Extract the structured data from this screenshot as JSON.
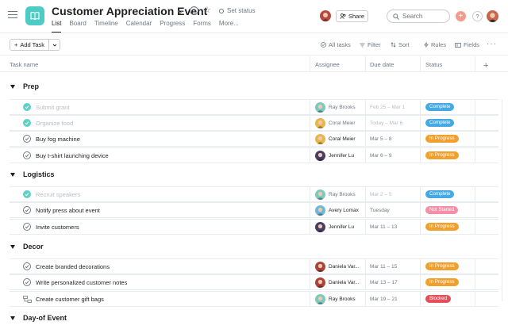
{
  "header": {
    "title": "Customer Appreciation Event",
    "set_status": "Set status",
    "tabs": [
      {
        "label": "List",
        "active": true
      },
      {
        "label": "Board"
      },
      {
        "label": "Timeline"
      },
      {
        "label": "Calendar"
      },
      {
        "label": "Progress"
      },
      {
        "label": "Forms"
      },
      {
        "label": "More..."
      }
    ],
    "share_label": "Share",
    "search_placeholder": "Search",
    "plus_icon": "plus-icon",
    "help_label": "?"
  },
  "toolbar": {
    "add_task_label": "Add Task",
    "all_tasks_label": "All tasks",
    "filter_label": "Filter",
    "sort_label": "Sort",
    "rules_label": "Rules",
    "fields_label": "Fields"
  },
  "columns": {
    "task_name": "Task name",
    "assignee": "Assignee",
    "due_date": "Due date",
    "status": "Status",
    "add_column": "+"
  },
  "status_colors": {
    "Complete": "#45a9e6",
    "In Progress": "#f1a02d",
    "Not Started": "#f48fa8",
    "Blocked": "#e2505b"
  },
  "sections": [
    {
      "name": "Prep",
      "tasks": [
        {
          "name": "Submit grant",
          "assignee": "Ray Brooks",
          "due": "Feb 25 – Mar 1",
          "status": "Complete",
          "complete": true,
          "avatar_color": "#7cc9c0"
        },
        {
          "name": "Organize food",
          "assignee": "Coral Meier",
          "due": "Today – Mar 6",
          "status": "Complete",
          "complete": true,
          "avatar_color": "#e8b64c"
        },
        {
          "name": "Buy fog machine",
          "assignee": "Coral Meier",
          "due": "Mar 5 – 8",
          "status": "In Progress",
          "complete": false,
          "avatar_color": "#e8b64c"
        },
        {
          "name": "Buy t-shirt launching device",
          "assignee": "Jennifer Lu",
          "due": "Mar 6 – 9",
          "status": "In Progress",
          "complete": false,
          "avatar_color": "#4a3e63"
        }
      ]
    },
    {
      "name": "Logistics",
      "tasks": [
        {
          "name": "Recruit speakers",
          "assignee": "Ray Brooks",
          "due": "Mar 2 – 5",
          "status": "Complete",
          "complete": true,
          "avatar_color": "#7cc9c0"
        },
        {
          "name": "Notify press about event",
          "assignee": "Avery Lomax",
          "due": "Tuesday",
          "status": "Not Started",
          "complete": false,
          "avatar_color": "#6fb7d6"
        },
        {
          "name": "Invite customers",
          "assignee": "Jennifer Lu",
          "due": "Mar 11 – 13",
          "status": "In Progress",
          "complete": false,
          "avatar_color": "#4a3e63"
        }
      ]
    },
    {
      "name": "Decor",
      "tasks": [
        {
          "name": "Create branded decorations",
          "assignee": "Daniela Var...",
          "due": "Mar 11 – 15",
          "status": "In Progress",
          "complete": false,
          "avatar_color": "#a8453c"
        },
        {
          "name": "Write personalized customer notes",
          "assignee": "Daniela Var...",
          "due": "Mar 13 – 17",
          "status": "In Progress",
          "complete": false,
          "avatar_color": "#a8453c"
        },
        {
          "name": "Create customer gift bags",
          "assignee": "Ray Brooks",
          "due": "Mar 19 – 21",
          "status": "Blocked",
          "complete": false,
          "subtask": true,
          "avatar_color": "#7cc9c0"
        }
      ]
    },
    {
      "name": "Day-of Event",
      "tasks": []
    }
  ]
}
